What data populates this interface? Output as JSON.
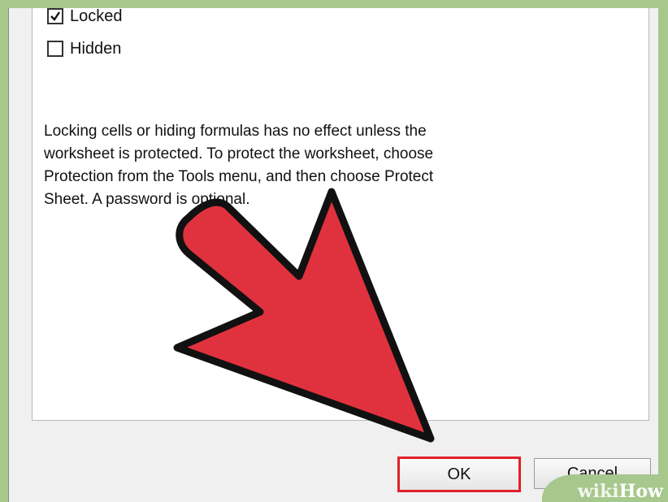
{
  "protection": {
    "locked_label": "Locked",
    "locked_checked": true,
    "hidden_label": "Hidden",
    "hidden_checked": false,
    "info_lines": [
      "Locking cells or hiding formulas has no effect unless the",
      "worksheet is protected. To protect the worksheet, choose",
      "Protection from the Tools menu, and then choose Protect",
      "Sheet. A password is optional."
    ]
  },
  "buttons": {
    "ok_label": "OK",
    "cancel_label": "Cancel"
  },
  "watermark": {
    "part1": "wiki",
    "part2": "How"
  },
  "colors": {
    "frame_green": "#a6c88c",
    "arrow_red": "#e0323e",
    "highlight_red": "#e0202a"
  },
  "annotation_icon": "red-arrow-pointer-icon"
}
